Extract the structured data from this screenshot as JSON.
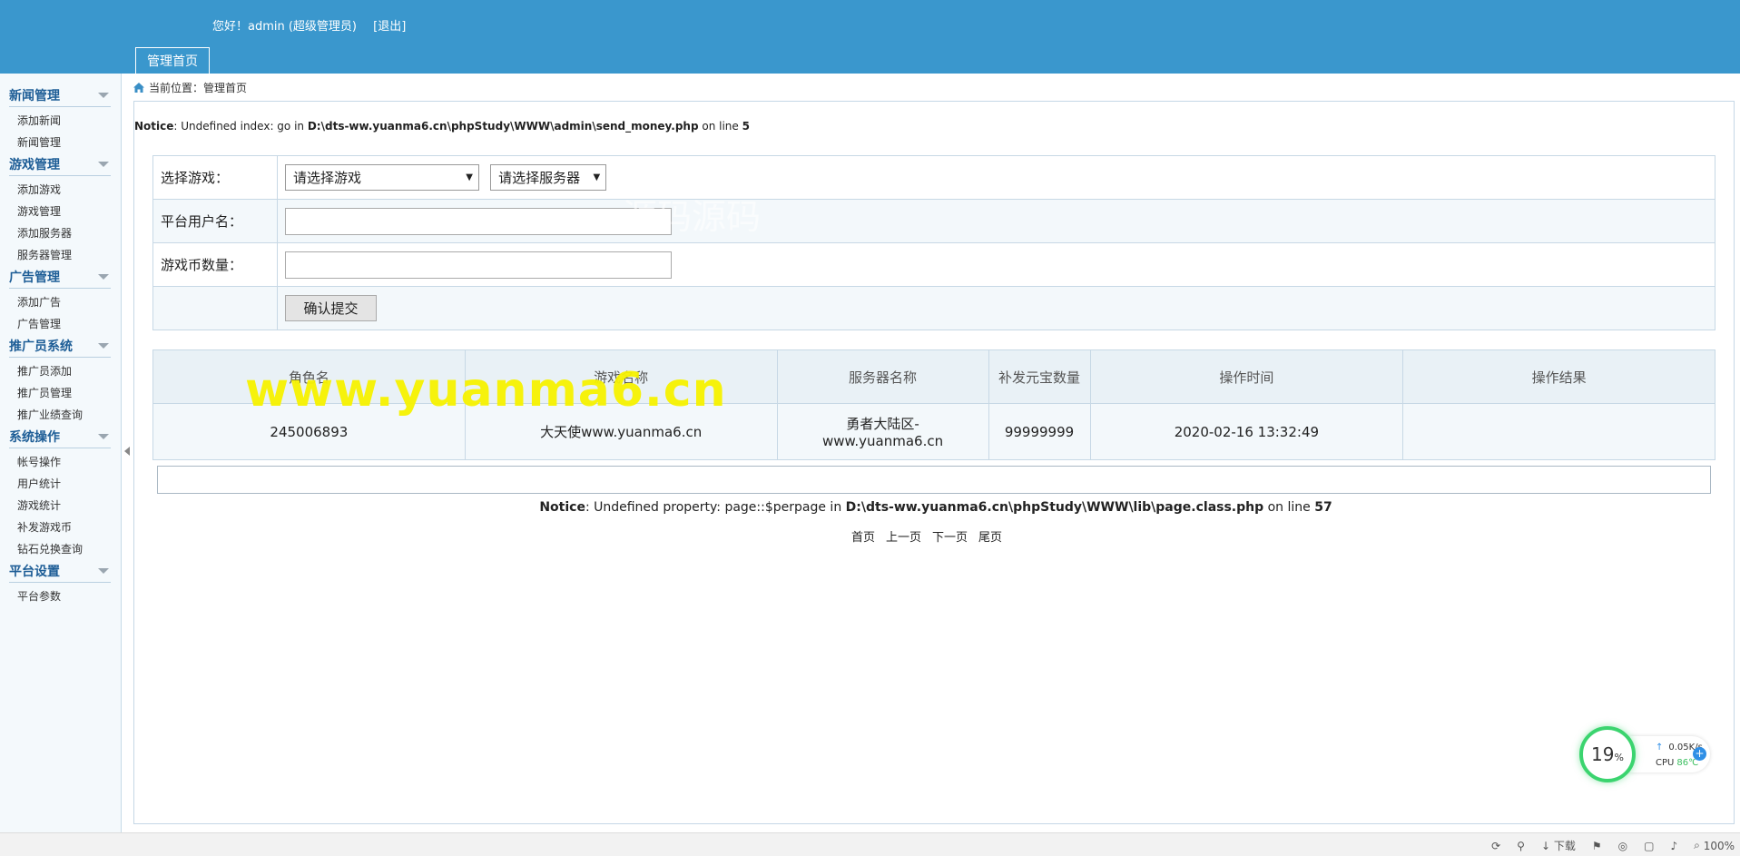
{
  "header": {
    "greeting": "您好！admin (超级管理员)",
    "logout": "[退出]",
    "tab": "管理首页"
  },
  "sidebar": {
    "groups": [
      {
        "title": "新闻管理",
        "items": [
          "添加新闻",
          "新闻管理"
        ]
      },
      {
        "title": "游戏管理",
        "items": [
          "添加游戏",
          "游戏管理",
          "添加服务器",
          "服务器管理"
        ]
      },
      {
        "title": "广告管理",
        "items": [
          "添加广告",
          "广告管理"
        ]
      },
      {
        "title": "推广员系统",
        "items": [
          "推广员添加",
          "推广员管理",
          "推广业绩查询"
        ]
      },
      {
        "title": "系统操作",
        "items": [
          "帐号操作",
          "用户统计",
          "游戏统计",
          "补发游戏币",
          "钻石兑换查询"
        ]
      },
      {
        "title": "平台设置",
        "items": [
          "平台参数"
        ]
      }
    ]
  },
  "breadcrumb": "当前位置：管理首页",
  "notice1": {
    "label": "Notice",
    "text1": ": Undefined index: go in ",
    "path": "D:\\dts-ww.yuanma6.cn\\phpStudy\\WWW\\admin\\send_money.php",
    "text2": " on line ",
    "line": "5"
  },
  "form": {
    "game_label": "选择游戏：",
    "game_select": "请选择游戏",
    "server_select": "请选择服务器",
    "username_label": "平台用户名：",
    "username_value": "",
    "coins_label": "游戏币数量：",
    "coins_value": "",
    "submit": "确认提交"
  },
  "table": {
    "headers": [
      "角色名",
      "游戏名称",
      "服务器名称",
      "补发元宝数量",
      "操作时间",
      "操作结果"
    ],
    "rows": [
      [
        "245006893",
        "大天使www.yuanma6.cn",
        "勇者大陆区-www.yuanma6.cn",
        "99999999",
        "2020-02-16 13:32:49",
        ""
      ]
    ]
  },
  "notice2": {
    "label": "Notice",
    "text1": ": Undefined property: page::$perpage in ",
    "path": "D:\\dts-ww.yuanma6.cn\\phpStudy\\WWW\\lib\\page.class.php",
    "text2": " on line ",
    "line": "57"
  },
  "pager": {
    "first": "首页",
    "prev": "上一页",
    "next": "下一页",
    "last": "尾页"
  },
  "watermark": {
    "main": "www.yuanma6.cn",
    "faint": "源码源码"
  },
  "cpu_widget": {
    "percent": "19",
    "unit": "%",
    "net": "0.05K/s",
    "cpu_label": "CPU",
    "temp": "86℃"
  },
  "statusbar": {
    "download": "下载",
    "zoom": "100%"
  },
  "colors": {
    "header": "#3a97cd",
    "sidebar_title": "#1d5d96",
    "watermark": "#f7f300",
    "cpu_ring": "#3bd46f"
  }
}
